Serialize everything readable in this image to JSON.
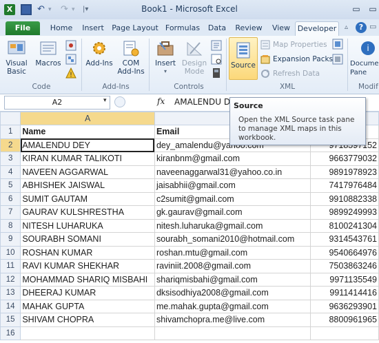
{
  "window": {
    "title": "Book1 - Microsoft Excel"
  },
  "quick_access": {
    "icons": [
      "excel-logo-icon",
      "save-icon",
      "undo-icon",
      "redo-icon",
      "customize-icon"
    ]
  },
  "tabs": [
    "File",
    "Home",
    "Insert",
    "Page Layout",
    "Formulas",
    "Data",
    "Review",
    "View",
    "Developer"
  ],
  "active_tab": "Developer",
  "ribbon": {
    "groups": {
      "code": "Code",
      "addins": "Add-Ins",
      "controls": "Controls",
      "xml": "XML",
      "modify": "Modif"
    },
    "buttons": {
      "visual_basic": "Visual Basic",
      "macros": "Macros",
      "add_ins": "Add-Ins",
      "com_add_ins": "COM Add-Ins",
      "insert": "Insert",
      "design_mode": "Design Mode",
      "source": "Source",
      "map_properties": "Map Properties",
      "expansion_packs": "Expansion Packs",
      "refresh_data": "Refresh Data",
      "document_panel": "Docume Pane"
    }
  },
  "formula_bar": {
    "name_box": "A2",
    "fx": "fx",
    "content": "AMALENDU D"
  },
  "tooltip": {
    "title": "Source",
    "body": "Open the XML Source task pane to manage XML maps in this workbook."
  },
  "sheet": {
    "columns": [
      "A",
      "",
      ""
    ],
    "rows": [
      {
        "n": "1",
        "a": "Name",
        "b": "Email",
        "c": ""
      },
      {
        "n": "2",
        "a": "AMALENDU DEY",
        "b": "dey_amalendu@yahoo.com",
        "c": "9718597152"
      },
      {
        "n": "3",
        "a": "KIRAN KUMAR TALIKOTI",
        "b": "kiranbnm@gmail.com",
        "c": "9663779032"
      },
      {
        "n": "4",
        "a": "NAVEEN AGGARWAL",
        "b": "naveenaggarwal31@yahoo.co.in",
        "c": "9891978923"
      },
      {
        "n": "5",
        "a": "ABHISHEK JAISWAL",
        "b": "jaisabhii@gmail.com",
        "c": "7417976484"
      },
      {
        "n": "6",
        "a": "SUMIT GAUTAM",
        "b": "c2sumit@gmail.com",
        "c": "9910882338"
      },
      {
        "n": "7",
        "a": "GAURAV KULSHRESTHA",
        "b": "gk.gaurav@gmail.com",
        "c": "9899249993"
      },
      {
        "n": "8",
        "a": "NITESH LUHARUKA",
        "b": "nitesh.luharuka@gmail.com",
        "c": "8100241304"
      },
      {
        "n": "9",
        "a": "SOURABH SOMANI",
        "b": "sourabh_somani2010@hotmail.com",
        "c": "9314543761"
      },
      {
        "n": "10",
        "a": "ROSHAN KUMAR",
        "b": "roshan.mtu@gmail.com",
        "c": "9540664976"
      },
      {
        "n": "11",
        "a": "RAVI KUMAR SHEKHAR",
        "b": "raviniit.2008@gmail.com",
        "c": "7503863246"
      },
      {
        "n": "12",
        "a": "MOHAMMAD SHARIQ MISBAHI",
        "b": "shariqmisbahi@gmail.com",
        "c": "9971135549"
      },
      {
        "n": "13",
        "a": "DHEERAJ KUMAR",
        "b": "dksisodhiya2008@gmail.com",
        "c": "9911414416"
      },
      {
        "n": "14",
        "a": "MAHAK GUPTA",
        "b": "me.mahak.gupta@gmail.com",
        "c": "9636293901"
      },
      {
        "n": "15",
        "a": "SHIVAM CHOPRA",
        "b": "shivamchopra.me@live.com",
        "c": "8800961965"
      },
      {
        "n": "16",
        "a": "",
        "b": "",
        "c": ""
      }
    ]
  },
  "colors": {
    "accent": "#1f7a2c",
    "selection_header": "#f5d98d"
  }
}
